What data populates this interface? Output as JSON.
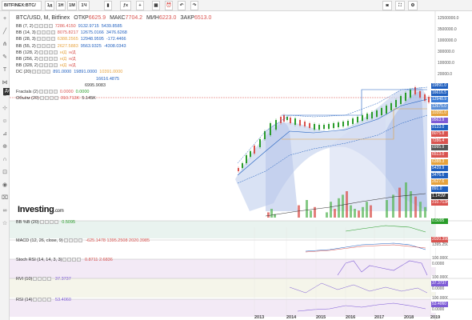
{
  "toolbar": {
    "symbol": "BITFINEX:BTC/",
    "intervals": [
      "1д",
      "1Н",
      "1М",
      "1Ч"
    ],
    "chart_type": "BTC/USD, M, Bitfinex"
  },
  "header": {
    "title": "BTC/USD, M, Bitfinex",
    "open_label": "ОТКР",
    "open": "6625.9",
    "high_label": "МАКС",
    "high": "7704.2",
    "low_label": "МИН",
    "low": "6223.0",
    "close_label": "ЗАКР",
    "close": "6513.0"
  },
  "indicators": [
    {
      "name": "BB (7, 2)",
      "values": [
        "7286.4150",
        "9132.9715",
        "5439.8585"
      ],
      "colors": [
        "#d9534f",
        "#1f5fbf",
        "#1f5fbf"
      ]
    },
    {
      "name": "BB (14, 3)",
      "values": [
        "8075.8217",
        "12675.0166",
        "3476.6268"
      ],
      "colors": [
        "#d9534f",
        "#1f5fbf",
        "#1f5fbf"
      ]
    },
    {
      "name": "BB (28, 3)",
      "values": [
        "6388.2565",
        "12948.9595",
        "-172.4466"
      ],
      "colors": [
        "#e6a23c",
        "#1f5fbf",
        "#1f5fbf"
      ]
    },
    {
      "name": "BB (55, 2)",
      "values": [
        "2627.5883",
        "9563.9325",
        "-4308.0343"
      ],
      "colors": [
        "#e6a23c",
        "#1f5fbf",
        "#1f5fbf"
      ]
    },
    {
      "name": "BB (128, 2)",
      "values": [
        "н/Д",
        "н/Д"
      ],
      "colors": [
        "#e6a23c",
        "#d9534f"
      ]
    },
    {
      "name": "BB (256, 2)",
      "values": [
        "н/Д",
        "н/Д"
      ],
      "colors": [
        "#e6a23c",
        "#d9534f"
      ]
    },
    {
      "name": "BB (328, 2)",
      "values": [
        "н/Д",
        "н/Д"
      ],
      "colors": [
        "#e6a23c",
        "#d9534f"
      ]
    },
    {
      "name": "DC (20)",
      "values": [
        "891.0000",
        "19891.0000",
        "10391.0000"
      ],
      "colors": [
        "#1f5fbf",
        "#1f5fbf",
        "#e6a23c"
      ]
    },
    {
      "name": "",
      "values": [
        "16616.4875"
      ],
      "colors": [
        "#1f5fbf"
      ]
    },
    {
      "name": "",
      "values": [
        "6995.9083"
      ],
      "colors": [
        "#333"
      ]
    },
    {
      "name": "Fractals (2)",
      "values": [
        "0.0000",
        "0.0000"
      ],
      "colors": [
        "#d9534f",
        "#2a9d2a"
      ]
    },
    {
      "name": "Объём (20)",
      "values": [
        "310.713K",
        "5.145K"
      ],
      "colors": [
        "#d9534f",
        "#333"
      ]
    }
  ],
  "tooltip": "Длинная позиция",
  "price_axis": [
    "12500000.0",
    "3500000.0",
    "1000000.0",
    "300000.0",
    "100000.0",
    "20000.0"
  ],
  "price_tags": [
    {
      "v": "19891.0",
      "c": "#1f5fbf"
    },
    {
      "v": "16616.5",
      "c": "#1f5fbf"
    },
    {
      "v": "12948.9",
      "c": "#3b7dd8"
    },
    {
      "v": "12675.0",
      "c": "#5a8fd6"
    },
    {
      "v": "10391.0",
      "c": "#e6a23c"
    },
    {
      "v": "9563.9",
      "c": "#7d5bd6"
    },
    {
      "v": "9133.0",
      "c": "#1f5fbf"
    },
    {
      "v": "8075.8",
      "c": "#d9534f"
    },
    {
      "v": "7286.4",
      "c": "#d9534f"
    },
    {
      "v": "6995.9",
      "c": "#555"
    },
    {
      "v": "6513.0",
      "c": "#d9534f"
    },
    {
      "v": "6388.3",
      "c": "#e6a23c"
    },
    {
      "v": "5439.9",
      "c": "#1f5fbf"
    },
    {
      "v": "3476.6",
      "c": "#1f5fbf"
    },
    {
      "v": "2627.6",
      "c": "#e6a23c"
    },
    {
      "v": "891.0",
      "c": "#1f5fbf"
    },
    {
      "v": "1.141M",
      "c": "#333"
    },
    {
      "v": "310.713K",
      "c": "#d9534f"
    }
  ],
  "panes": [
    {
      "label": "BB %B (20)",
      "value": "0.5095",
      "val_color": "#2a9d2a",
      "axis": [
        "0.5095"
      ]
    },
    {
      "label": "MACD (12, 26, close, 9)",
      "value": "-625.1478   1395.2508   2020.3985",
      "val_color": "#d9534f",
      "axis": [
        "2020.3985",
        "1395.2508"
      ]
    },
    {
      "label": "Stoch RSI (14, 14, 3, 3)",
      "value": "0.8711   2.6836",
      "val_color": "#d9534f",
      "axis": [
        "100.0000",
        "0.0000"
      ]
    },
    {
      "label": "RVI (10)",
      "value": "37.3737",
      "val_color": "#7d5bd6",
      "axis": [
        "100.0000",
        "37.3737",
        "0.0000"
      ]
    },
    {
      "label": "RSI (14)",
      "value": "53.4060",
      "val_color": "#7d5bd6",
      "axis": [
        "100.0000",
        "53.4060",
        "0.0000"
      ]
    }
  ],
  "x_labels": [
    "2013",
    "2014",
    "2015",
    "2016",
    "2017",
    "2018",
    "2019"
  ],
  "logo": "Investing",
  "logo_suffix": ".com"
}
